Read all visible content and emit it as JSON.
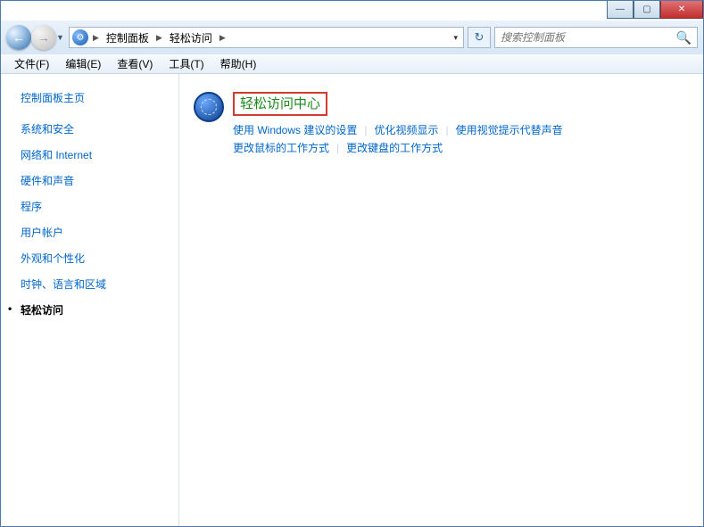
{
  "caption": {
    "min": "—",
    "max": "▢",
    "close": "✕"
  },
  "nav": {
    "breadcrumb": [
      "控制面板",
      "轻松访问"
    ],
    "search_placeholder": "搜索控制面板"
  },
  "menu": [
    "文件(F)",
    "编辑(E)",
    "查看(V)",
    "工具(T)",
    "帮助(H)"
  ],
  "sidebar": {
    "home": "控制面板主页",
    "items": [
      {
        "label": "系统和安全"
      },
      {
        "label": "网络和 Internet"
      },
      {
        "label": "硬件和声音"
      },
      {
        "label": "程序"
      },
      {
        "label": "用户帐户"
      },
      {
        "label": "外观和个性化"
      },
      {
        "label": "时钟、语言和区域"
      },
      {
        "label": "轻松访问",
        "active": true
      }
    ]
  },
  "main": {
    "title": "轻松访问中心",
    "links": [
      "使用 Windows 建议的设置",
      "优化视频显示",
      "使用视觉提示代替声音",
      "更改鼠标的工作方式",
      "更改键盘的工作方式"
    ]
  }
}
